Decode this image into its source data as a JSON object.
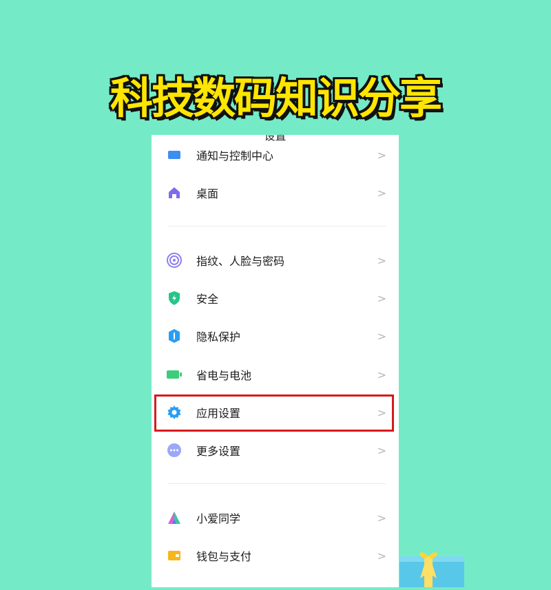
{
  "banner": {
    "title": "科技数码知识分享"
  },
  "settings": {
    "header_title": "设置",
    "items": [
      {
        "label": "通知与控制中心",
        "icon": "notification-icon"
      },
      {
        "label": "桌面",
        "icon": "home-icon"
      },
      {
        "label": "指纹、人脸与密码",
        "icon": "fingerprint-icon"
      },
      {
        "label": "安全",
        "icon": "shield-icon"
      },
      {
        "label": "隐私保护",
        "icon": "privacy-icon"
      },
      {
        "label": "省电与电池",
        "icon": "battery-icon"
      },
      {
        "label": "应用设置",
        "icon": "gear-icon"
      },
      {
        "label": "更多设置",
        "icon": "more-icon"
      },
      {
        "label": "小爱同学",
        "icon": "assistant-icon"
      },
      {
        "label": "钱包与支付",
        "icon": "wallet-icon"
      }
    ],
    "chevron": ">"
  },
  "colors": {
    "background": "#74ebc6",
    "title_yellow": "#ffe600",
    "highlight_red": "#d7191c",
    "accent_blue": "#2a9df4",
    "green": "#2ecc71",
    "purple": "#7b6cf0"
  }
}
